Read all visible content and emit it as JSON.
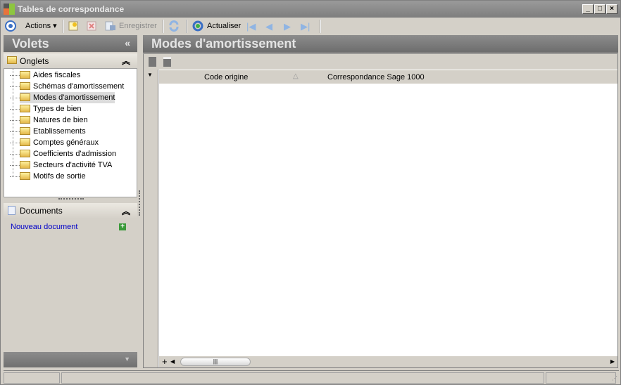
{
  "window": {
    "title": "Tables de correspondance",
    "min": "_",
    "max": "□",
    "close": "×"
  },
  "toolbar": {
    "actions": "Actions",
    "save": "Enregistrer",
    "refresh": "Actualiser"
  },
  "volets": {
    "title": "Volets",
    "collapse": "«",
    "onglets": {
      "title": "Onglets",
      "items": [
        "Aides fiscales",
        "Schémas d'amortissement",
        "Modes d'amortissement",
        "Types de bien",
        "Natures de bien",
        "Etablissements",
        "Comptes généraux",
        "Coefficients d'admission",
        "Secteurs d'activité TVA",
        "Motifs de sortie"
      ],
      "selected": 2
    },
    "documents": {
      "title": "Documents",
      "new_doc": "Nouveau document"
    }
  },
  "main": {
    "title": "Modes d'amortissement",
    "columns": [
      "Code origine",
      "Correspondance Sage 1000"
    ],
    "add": "+"
  }
}
